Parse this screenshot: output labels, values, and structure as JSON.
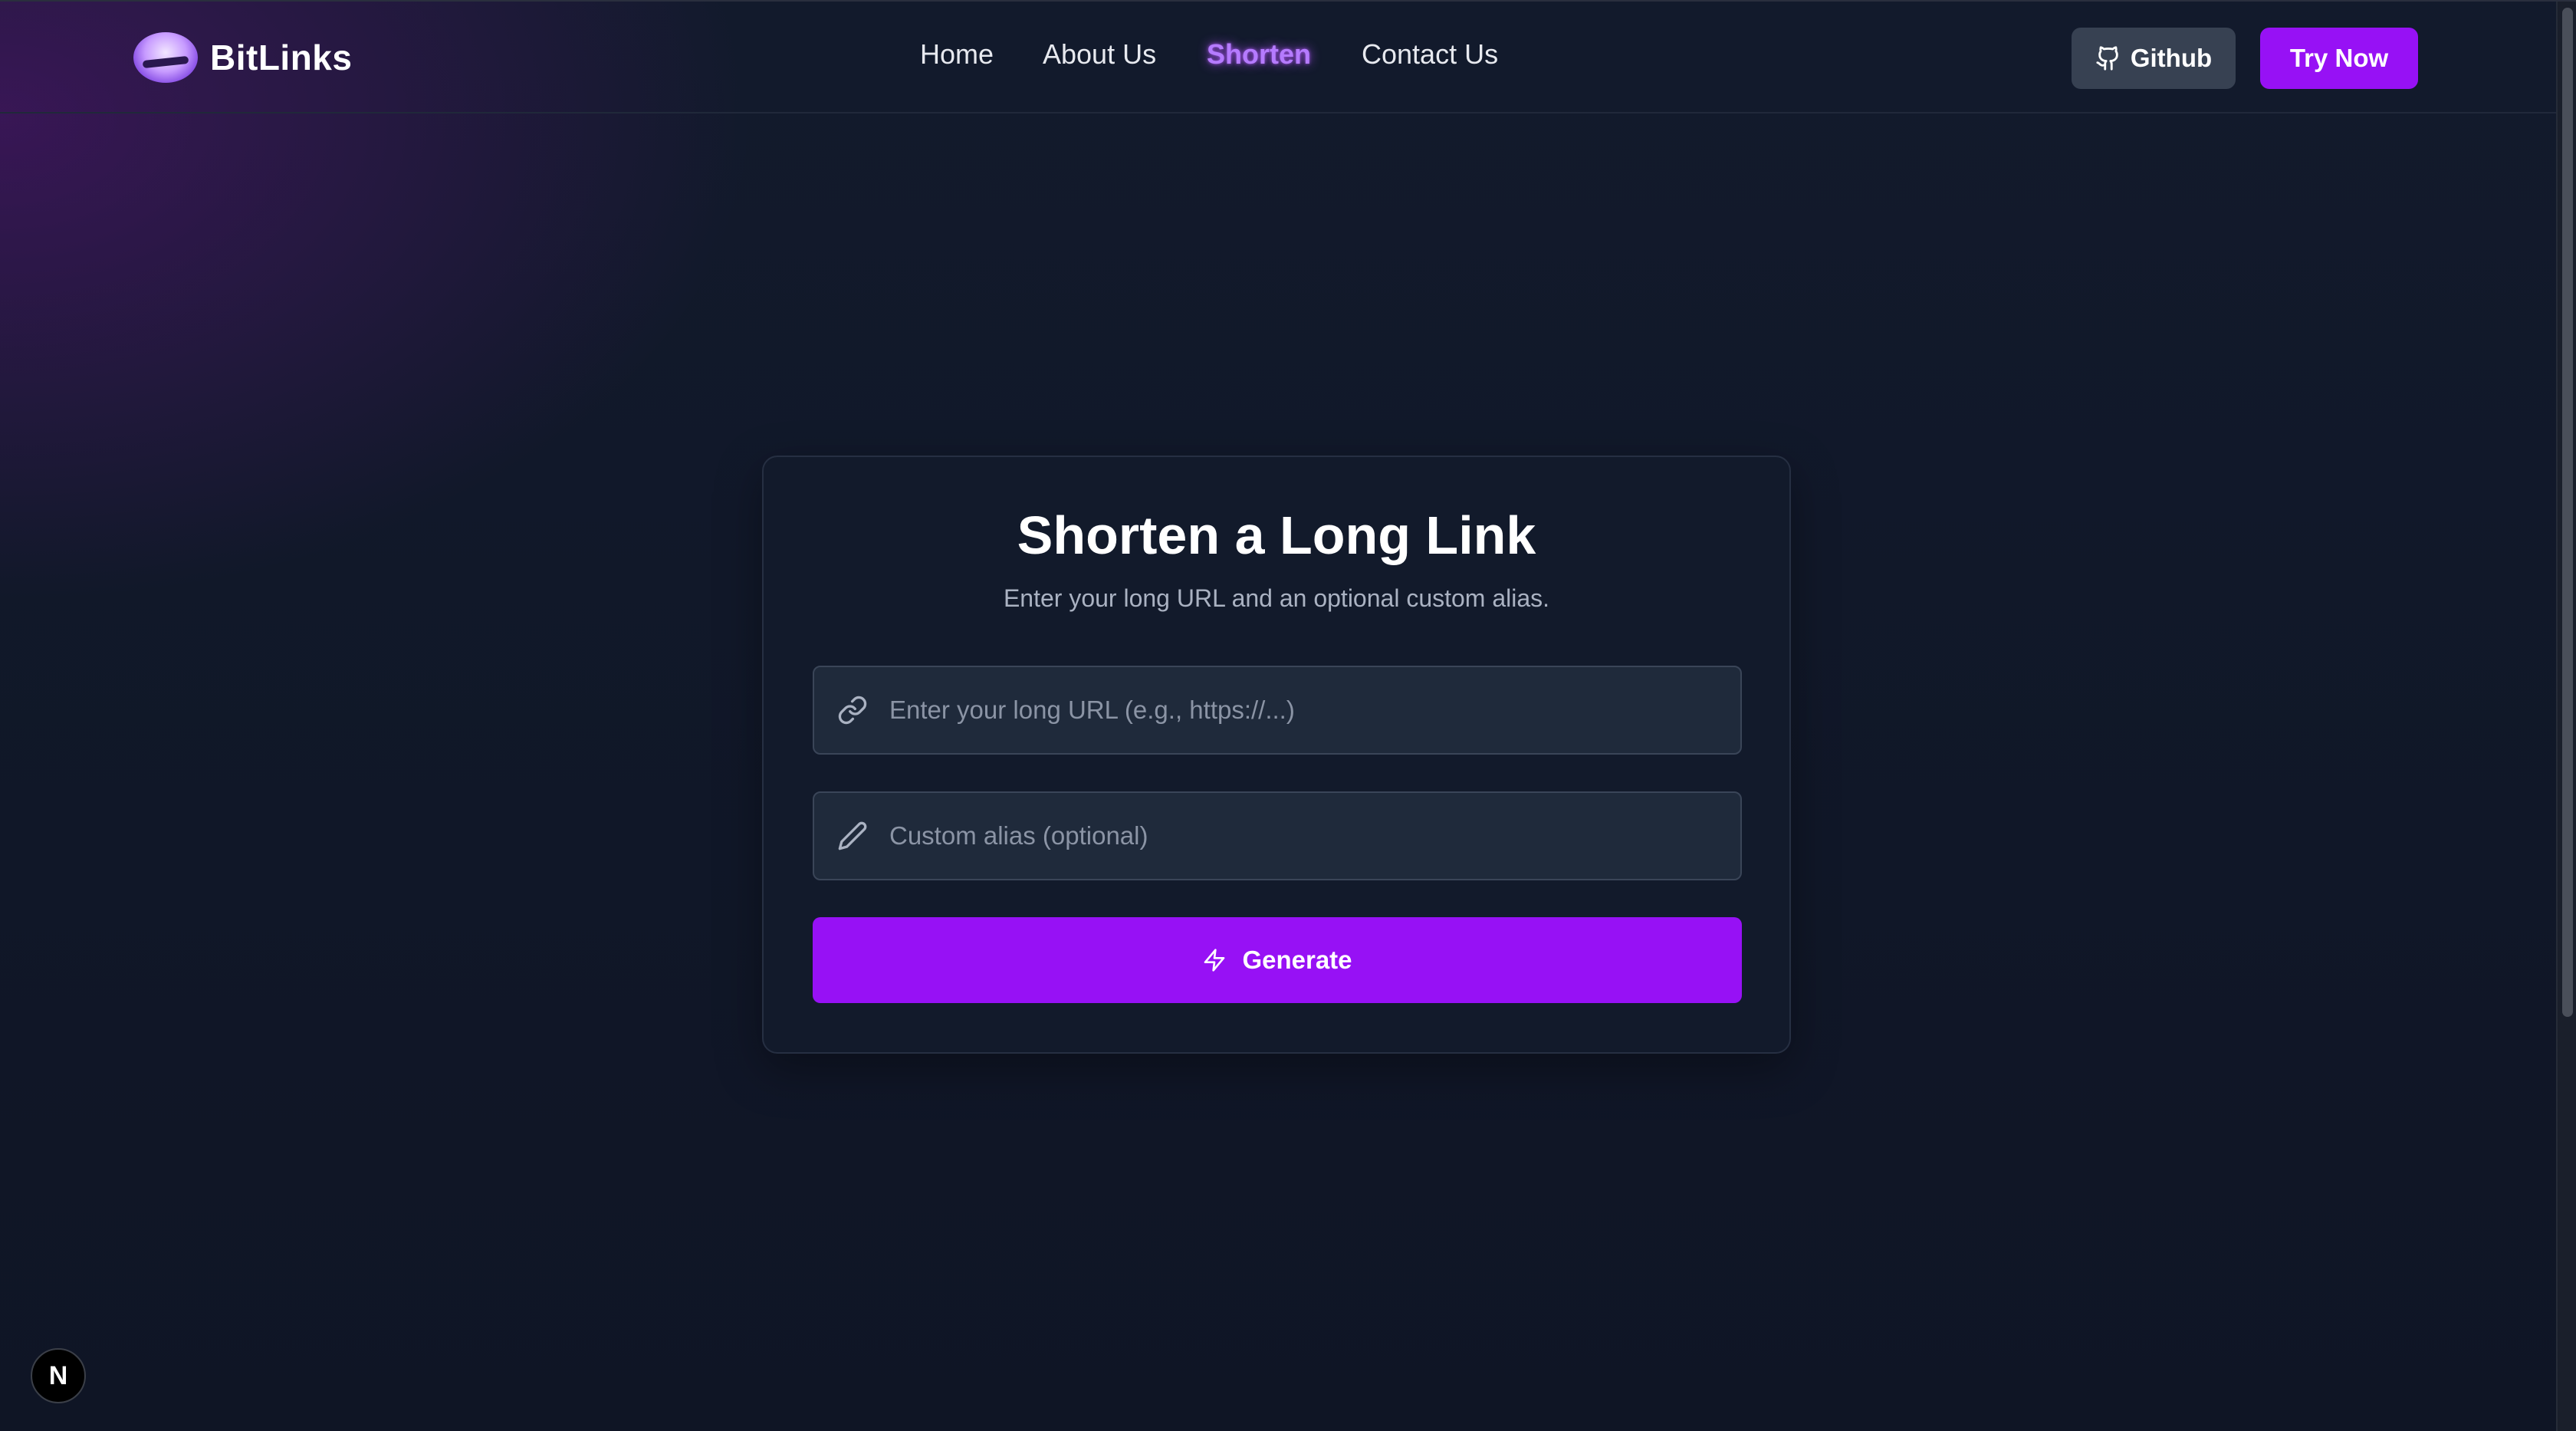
{
  "brand": {
    "name": "BitLinks"
  },
  "nav": {
    "links": [
      {
        "label": "Home",
        "active": false
      },
      {
        "label": "About Us",
        "active": false
      },
      {
        "label": "Shorten",
        "active": true
      },
      {
        "label": "Contact Us",
        "active": false
      }
    ],
    "github_label": "Github",
    "try_label": "Try Now"
  },
  "card": {
    "title": "Shorten a Long Link",
    "subtitle": "Enter your long URL and an optional custom alias.",
    "url_field": {
      "placeholder": "Enter your long URL (e.g., https://...)",
      "value": "",
      "icon": "link-icon"
    },
    "alias_field": {
      "placeholder": "Custom alias (optional)",
      "value": "",
      "icon": "pencil-icon"
    },
    "generate_label": "Generate",
    "generate_icon": "lightning-icon"
  },
  "dev_badge": {
    "label": "N"
  },
  "colors": {
    "accent": "#9711f5",
    "active_link": "#b57bff",
    "background": "#101626",
    "card": "#121a2b",
    "github_button": "#374152"
  }
}
